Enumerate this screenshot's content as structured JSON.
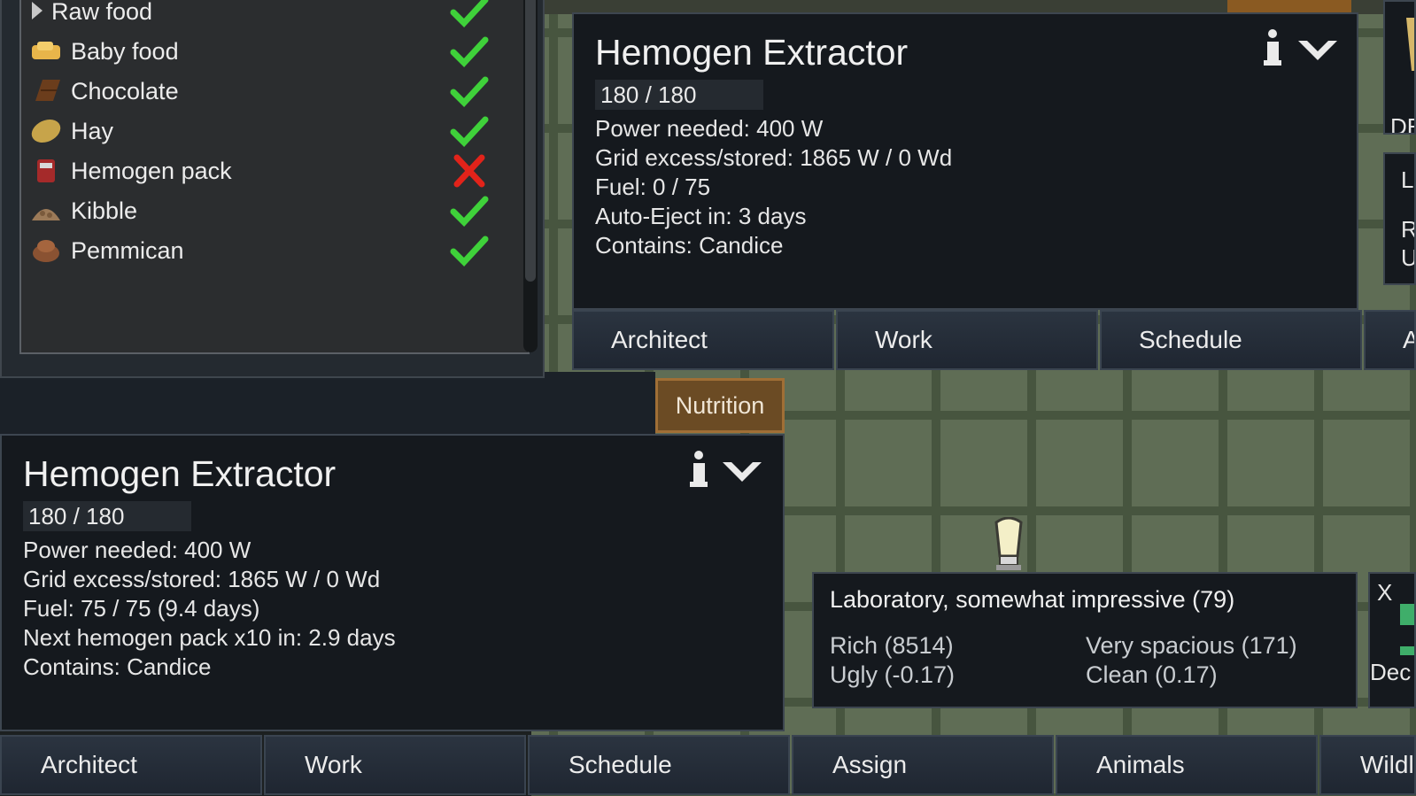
{
  "food_filter": {
    "items": [
      {
        "label": "Raw food",
        "icon": "expand-triangle-icon",
        "allowed": true
      },
      {
        "label": "Baby food",
        "icon": "baby-food-icon",
        "allowed": true
      },
      {
        "label": "Chocolate",
        "icon": "chocolate-icon",
        "allowed": true
      },
      {
        "label": "Hay",
        "icon": "hay-icon",
        "allowed": true
      },
      {
        "label": "Hemogen pack",
        "icon": "hemogen-pack-icon",
        "allowed": false
      },
      {
        "label": "Kibble",
        "icon": "kibble-icon",
        "allowed": true
      },
      {
        "label": "Pemmican",
        "icon": "pemmican-icon",
        "allowed": true
      }
    ],
    "colors": {
      "check": "#3fd13a",
      "cross": "#e2231a"
    }
  },
  "inspect_top": {
    "title": "Hemogen Extractor",
    "hp": "180 / 180",
    "lines": [
      "Power needed: 400 W",
      "Grid excess/stored: 1865 W / 0 Wd",
      "Fuel: 0 / 75",
      "Auto-Eject in: 3 days",
      "Contains: Candice"
    ]
  },
  "inspect_bottom": {
    "title": "Hemogen Extractor",
    "hp": "180 / 180",
    "lines": [
      "Power needed: 400 W",
      "Grid excess/stored: 1865 W / 0 Wd",
      "Fuel: 75 / 75 (9.4 days)",
      "Next hemogen pack x10 in: 2.9 days",
      "Contains: Candice"
    ]
  },
  "tabs_top": [
    "Architect",
    "Work",
    "Schedule",
    "A"
  ],
  "tabs_bottom": [
    "Architect",
    "Work",
    "Schedule",
    "Assign",
    "Animals",
    "Wildl"
  ],
  "nutrition_label": "Nutrition",
  "room": {
    "title": "Laboratory, somewhat impressive (79)",
    "stats": [
      "Rich (8514)",
      "Very spacious (171)",
      "Ugly (-0.17)",
      "Clean (0.17)"
    ]
  },
  "edge_fragments": {
    "de": "DE",
    "l": "L",
    "r": "R",
    "u": "U",
    "x": "X",
    "dec": "Dec"
  }
}
